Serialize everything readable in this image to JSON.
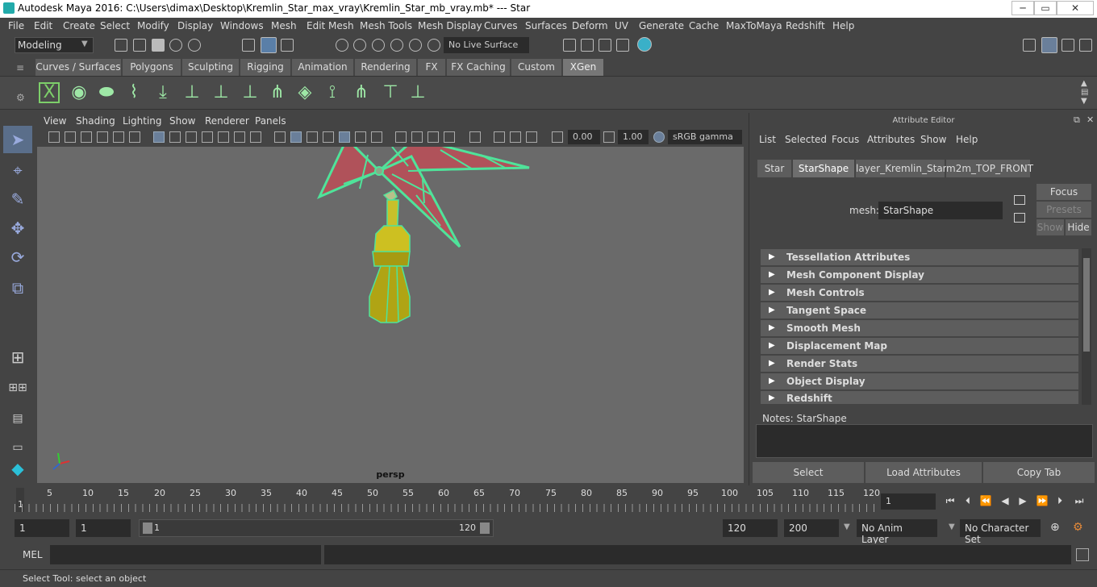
{
  "window": {
    "title": "Autodesk Maya 2016: C:\\Users\\dimax\\Desktop\\Kremlin_Star_max_vray\\Kremlin_Star_mb_vray.mb*  ---  Star",
    "minimize": "─",
    "maximize": "▭",
    "close": "✕"
  },
  "menubar": [
    "File",
    "Edit",
    "Create",
    "Select",
    "Modify",
    "Display",
    "Windows",
    "Mesh",
    "Edit Mesh",
    "Mesh Tools",
    "Mesh Display",
    "Curves",
    "Surfaces",
    "Deform",
    "UV",
    "Generate",
    "Cache",
    "MaxToMaya",
    "Redshift",
    "Help"
  ],
  "statusline": {
    "mode": "Modeling",
    "live_surface": "No Live Surface"
  },
  "shelf_tabs": [
    "Curves / Surfaces",
    "Polygons",
    "Sculpting",
    "Rigging",
    "Animation",
    "Rendering",
    "FX",
    "FX Caching",
    "Custom",
    "XGen"
  ],
  "shelf_active": "XGen",
  "viewport": {
    "menu": [
      "View",
      "Shading",
      "Lighting",
      "Show",
      "Renderer",
      "Panels"
    ],
    "exposure": "0.00",
    "gamma": "1.00",
    "color_space": "sRGB gamma",
    "camera_label": "persp"
  },
  "attribute_editor": {
    "title": "Attribute Editor",
    "menu": [
      "List",
      "Selected",
      "Focus",
      "Attributes",
      "Show",
      "Help"
    ],
    "tabs": [
      "Star",
      "StarShape",
      "layer_Kremlin_Star",
      "m2m_TOP_FRONT"
    ],
    "active_tab": "StarShape",
    "mesh_label": "mesh:",
    "mesh_value": "StarShape",
    "focus_btn": "Focus",
    "presets_btn": "Presets",
    "show_btn": "Show",
    "hide_btn": "Hide",
    "sections": [
      "Tessellation Attributes",
      "Mesh Component Display",
      "Mesh Controls",
      "Tangent Space",
      "Smooth Mesh",
      "Displacement Map",
      "Render Stats",
      "Object Display",
      "Redshift"
    ],
    "notes_label": "Notes:  StarShape",
    "buttons": [
      "Select",
      "Load Attributes",
      "Copy Tab"
    ]
  },
  "timeline": {
    "ticks": [
      "5",
      "10",
      "15",
      "20",
      "25",
      "30",
      "35",
      "40",
      "45",
      "50",
      "55",
      "60",
      "65",
      "70",
      "75",
      "80",
      "85",
      "90",
      "95",
      "100",
      "105",
      "110",
      "115",
      "120"
    ],
    "start_marker": "1",
    "current_frame": "1"
  },
  "range": {
    "start": "1",
    "playback_start": "1",
    "slider_start": "1",
    "slider_end": "120",
    "playback_end": "120",
    "end": "200",
    "anim_layer": "No Anim Layer",
    "character_set": "No Character Set"
  },
  "mel": {
    "label": "MEL"
  },
  "help_line": "Select Tool: select an object",
  "colors": {
    "wire": "#4fe39a",
    "star_face": "#b0525a",
    "spire": "#b8b022"
  }
}
